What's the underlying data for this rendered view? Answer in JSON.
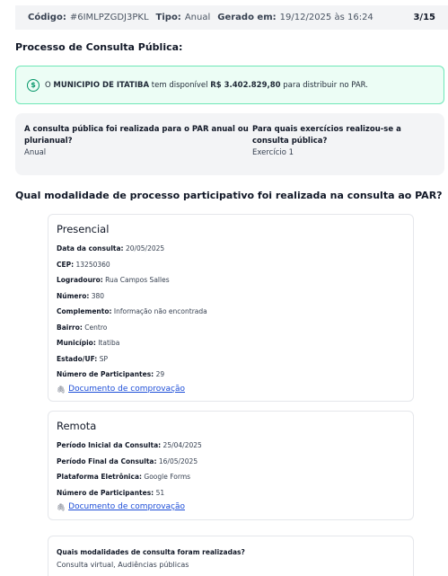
{
  "header": {
    "codigo_label": "Código:",
    "codigo_value": "#6IMLPZGDJ3PKL",
    "tipo_label": "Tipo:",
    "tipo_value": "Anual",
    "gerado_label": "Gerado em:",
    "gerado_value": "19/12/2025 às 16:24",
    "page": "3/15"
  },
  "section_title": "Processo de Consulta Pública:",
  "alert": {
    "prefix": "O",
    "entity": "MUNICIPIO DE ITATIBA",
    "middle": "tem disponível",
    "amount": "R$ 3.402.829,80",
    "suffix": "para distribuir no PAR."
  },
  "info": {
    "q1": "A consulta pública foi realizada para o PAR anual ou plurianual?",
    "a1": "Anual",
    "q2": "Para quais exercícios realizou-se a consulta pública?",
    "a2": "Exercício 1"
  },
  "modalidade_title": "Qual modalidade de processo participativo foi realizada na consulta ao PAR?",
  "presencial": {
    "title": "Presencial",
    "fields": [
      {
        "label": "Data da consulta:",
        "value": "20/05/2025"
      },
      {
        "label": "CEP:",
        "value": "13250360"
      },
      {
        "label": "Logradouro:",
        "value": "Rua Campos Salles"
      },
      {
        "label": "Número:",
        "value": "380"
      },
      {
        "label": "Complemento:",
        "value": "Informação não encontrada"
      },
      {
        "label": "Bairro:",
        "value": "Centro"
      },
      {
        "label": "Município:",
        "value": "Itatiba"
      },
      {
        "label": "Estado/UF:",
        "value": "SP"
      },
      {
        "label": "Número de Participantes:",
        "value": "29"
      }
    ],
    "doc_link": "Documento de comprovação"
  },
  "remota": {
    "title": "Remota",
    "fields": [
      {
        "label": "Período Inicial da Consulta:",
        "value": "25/04/2025"
      },
      {
        "label": "Período Final da Consulta:",
        "value": "16/05/2025"
      },
      {
        "label": "Plataforma Eletrônica:",
        "value": "Google Forms"
      },
      {
        "label": "Número de Participantes:",
        "value": "51"
      }
    ],
    "doc_link": "Documento de comprovação"
  },
  "modalidades": {
    "question": "Quais modalidades de consulta foram realizadas?",
    "answer": "Consulta virtual, Audiências públicas"
  }
}
